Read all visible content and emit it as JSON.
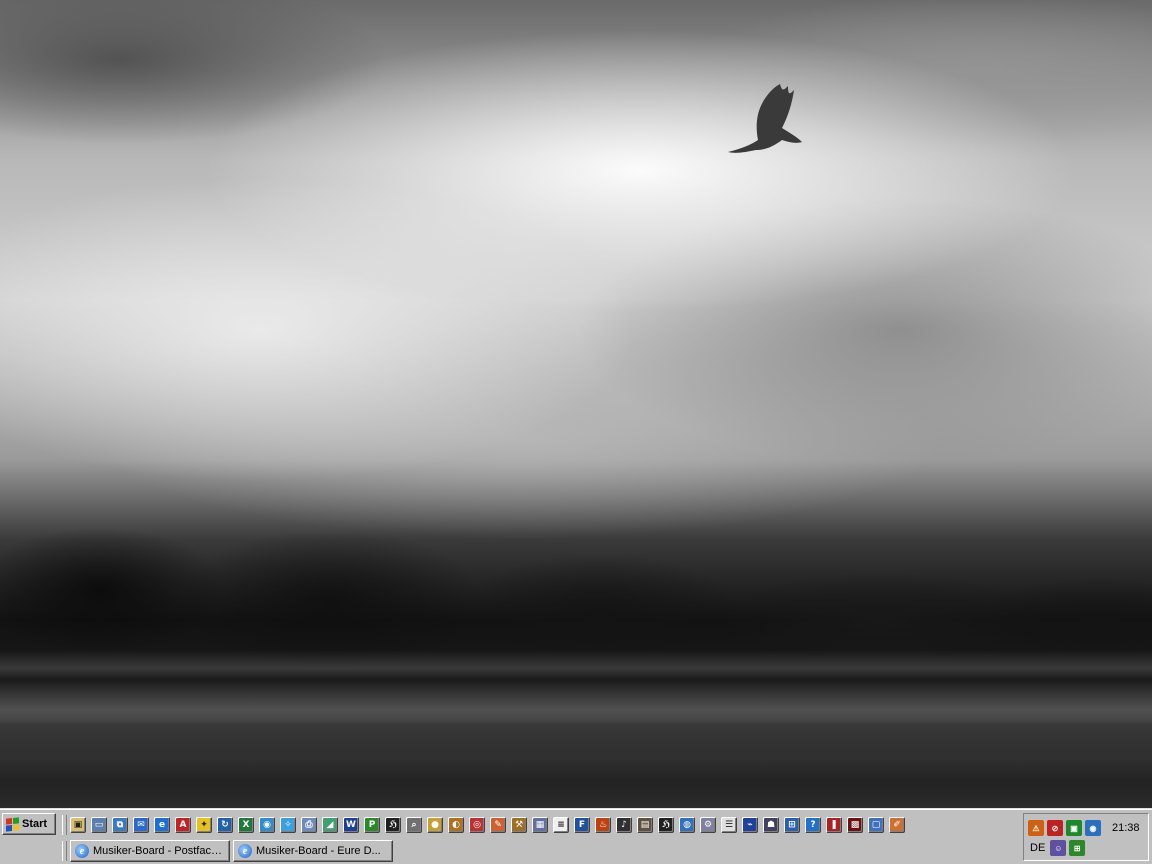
{
  "taskbar": {
    "start_label": "Start",
    "quick_launch": [
      {
        "icon": "show-desktop-icon",
        "color": "#d8c070",
        "glyph": "▣"
      },
      {
        "icon": "my-computer-icon",
        "color": "#5a7fb0",
        "glyph": "▭"
      },
      {
        "icon": "network-icon",
        "color": "#3c78c8",
        "glyph": "⧉"
      },
      {
        "icon": "outlook-express-icon",
        "color": "#2a6ad0",
        "glyph": "✉"
      },
      {
        "icon": "internet-explorer-icon",
        "color": "#1d6fd8",
        "glyph": "e"
      },
      {
        "icon": "acrobat-reader-icon",
        "color": "#c82020",
        "glyph": "A"
      },
      {
        "icon": "aim-icon",
        "color": "#e8c020",
        "glyph": "✦"
      },
      {
        "icon": "windows-update-icon",
        "color": "#2060b0",
        "glyph": "↻"
      },
      {
        "icon": "excel-icon",
        "color": "#1d7a3a",
        "glyph": "X"
      },
      {
        "icon": "browser-globe-icon",
        "color": "#2f8cd0",
        "glyph": "◉"
      },
      {
        "icon": "safari-compass-icon",
        "color": "#3aa0e0",
        "glyph": "✧"
      },
      {
        "icon": "printer-icon",
        "color": "#6a8cc0",
        "glyph": "⎙"
      },
      {
        "icon": "scanner-icon",
        "color": "#40a070",
        "glyph": "◢"
      },
      {
        "icon": "word-icon",
        "color": "#1a3fa0",
        "glyph": "W"
      },
      {
        "icon": "pro-tools-icon",
        "color": "#2a8a2a",
        "glyph": "P"
      },
      {
        "icon": "music-app-icon",
        "color": "#202020",
        "glyph": "ℌ"
      },
      {
        "icon": "search-magnifier-icon",
        "color": "#707070",
        "glyph": "⌕"
      },
      {
        "icon": "media-player-icon",
        "color": "#c8a030",
        "glyph": "●"
      },
      {
        "icon": "winamp-icon",
        "color": "#b07020",
        "glyph": "◐"
      },
      {
        "icon": "cd-burner-icon",
        "color": "#c03030",
        "glyph": "◎"
      },
      {
        "icon": "paint-icon",
        "color": "#d06030",
        "glyph": "✎"
      },
      {
        "icon": "tools-icon",
        "color": "#a07020",
        "glyph": "⚒"
      },
      {
        "icon": "image-viewer-icon",
        "color": "#6070a0",
        "glyph": "▦"
      },
      {
        "icon": "notepad-icon",
        "color": "#f0f0f0",
        "glyph": "≡"
      },
      {
        "icon": "fp-app-icon",
        "color": "#2050a0",
        "glyph": "F"
      },
      {
        "icon": "fire-app-icon",
        "color": "#c04010",
        "glyph": "♨"
      },
      {
        "icon": "guitar-app-icon",
        "color": "#303030",
        "glyph": "♪"
      },
      {
        "icon": "sequencer-icon",
        "color": "#605040",
        "glyph": "▤"
      },
      {
        "icon": "music-editor-icon",
        "color": "#202020",
        "glyph": "ℌ"
      },
      {
        "icon": "messenger-icon",
        "color": "#3070c0",
        "glyph": "◍"
      },
      {
        "icon": "settings-app-icon",
        "color": "#8080a0",
        "glyph": "⚙"
      },
      {
        "icon": "notes-icon",
        "color": "#e0e0e0",
        "glyph": "☰"
      },
      {
        "icon": "usb-device-icon",
        "color": "#2040a0",
        "glyph": "⌁"
      },
      {
        "icon": "game-icon",
        "color": "#404060",
        "glyph": "☗"
      },
      {
        "icon": "office-app-icon",
        "color": "#2a60b0",
        "glyph": "⊞"
      },
      {
        "icon": "help-app-icon",
        "color": "#2070d0",
        "glyph": "?"
      },
      {
        "icon": "red-app-icon",
        "color": "#b02020",
        "glyph": "❚"
      },
      {
        "icon": "dark-red-app-icon",
        "color": "#701010",
        "glyph": "▩"
      },
      {
        "icon": "window-app-icon",
        "color": "#4070c0",
        "glyph": "▢"
      },
      {
        "icon": "paint-brush-icon",
        "color": "#d07030",
        "glyph": "✐"
      }
    ],
    "tasks": [
      {
        "label": "Musiker-Board - Postfach..."
      },
      {
        "label": "Musiker-Board - Eure D..."
      }
    ],
    "tray": {
      "clock": "21:38",
      "language": "DE",
      "icons_top": [
        {
          "icon": "antivirus-icon",
          "color": "#d06010",
          "glyph": "⚠"
        },
        {
          "icon": "no-entry-icon",
          "color": "#c02020",
          "glyph": "⊘"
        },
        {
          "icon": "network-monitor-icon",
          "color": "#1a8a2a",
          "glyph": "▣"
        },
        {
          "icon": "globe-status-icon",
          "color": "#2a70c0",
          "glyph": "◉"
        }
      ],
      "icons_bottom": [
        {
          "icon": "user-status-icon",
          "color": "#6050a0",
          "glyph": "☺"
        },
        {
          "icon": "grid-status-icon",
          "color": "#2a8a2a",
          "glyph": "⊞"
        }
      ]
    }
  }
}
